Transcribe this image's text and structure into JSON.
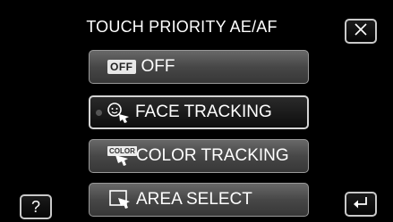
{
  "header": {
    "title": "TOUCH PRIORITY AE/AF"
  },
  "buttons": {
    "close_icon": "close-icon",
    "help_label": "?",
    "return_icon": "return-icon"
  },
  "options": [
    {
      "label": "OFF",
      "icon": "off-icon",
      "icon_text": "OFF",
      "selected": false
    },
    {
      "label": "FACE TRACKING",
      "icon": "face-tracking-icon",
      "selected": true
    },
    {
      "label": "COLOR TRACKING",
      "icon": "color-tracking-icon",
      "icon_text": "COLOR",
      "selected": false
    },
    {
      "label": "AREA SELECT",
      "icon": "area-select-icon",
      "selected": false
    }
  ],
  "colors": {
    "background": "#000000",
    "option_fill": "#474747",
    "selected_fill": "#111111",
    "text": "#ffffff"
  }
}
